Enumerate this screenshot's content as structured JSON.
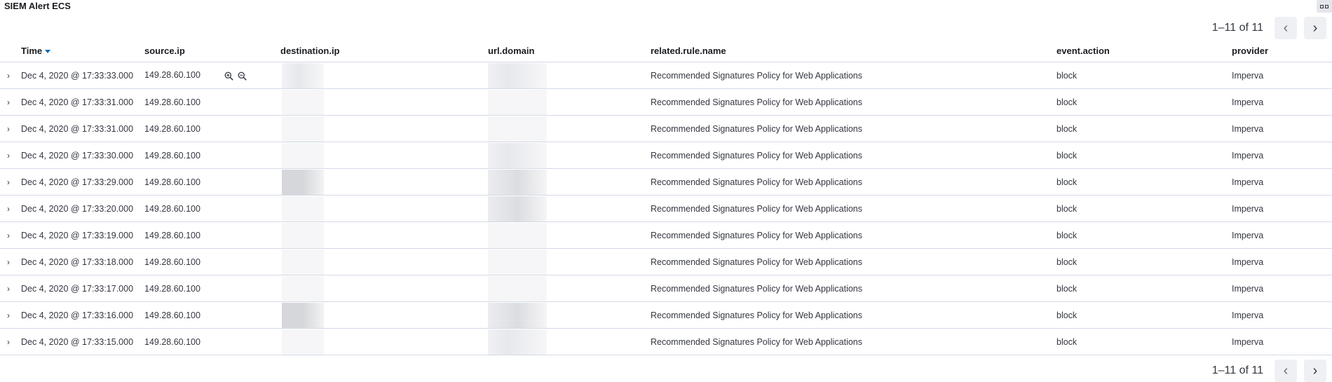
{
  "panel": {
    "title": "SIEM Alert ECS"
  },
  "pagination": {
    "range": "1–11 of 11"
  },
  "columns": {
    "time": "Time",
    "source_ip": "source.ip",
    "destination_ip": "destination.ip",
    "url_domain": "url.domain",
    "rule_name": "related.rule.name",
    "event_action": "event.action",
    "provider": "provider"
  },
  "rows": [
    {
      "time": "Dec 4, 2020 @ 17:33:33.000",
      "source_ip": "149.28.60.100",
      "destination_ip": "",
      "url_domain": "",
      "rule_name": "Recommended Signatures Policy for Web Applications",
      "event_action": "block",
      "provider": "Imperva"
    },
    {
      "time": "Dec 4, 2020 @ 17:33:31.000",
      "source_ip": "149.28.60.100",
      "destination_ip": "",
      "url_domain": "",
      "rule_name": "Recommended Signatures Policy for Web Applications",
      "event_action": "block",
      "provider": "Imperva"
    },
    {
      "time": "Dec 4, 2020 @ 17:33:31.000",
      "source_ip": "149.28.60.100",
      "destination_ip": "",
      "url_domain": "",
      "rule_name": "Recommended Signatures Policy for Web Applications",
      "event_action": "block",
      "provider": "Imperva"
    },
    {
      "time": "Dec 4, 2020 @ 17:33:30.000",
      "source_ip": "149.28.60.100",
      "destination_ip": "",
      "url_domain": "",
      "rule_name": "Recommended Signatures Policy for Web Applications",
      "event_action": "block",
      "provider": "Imperva"
    },
    {
      "time": "Dec 4, 2020 @ 17:33:29.000",
      "source_ip": "149.28.60.100",
      "destination_ip": "",
      "url_domain": "",
      "rule_name": "Recommended Signatures Policy for Web Applications",
      "event_action": "block",
      "provider": "Imperva"
    },
    {
      "time": "Dec 4, 2020 @ 17:33:20.000",
      "source_ip": "149.28.60.100",
      "destination_ip": "",
      "url_domain": "",
      "rule_name": "Recommended Signatures Policy for Web Applications",
      "event_action": "block",
      "provider": "Imperva"
    },
    {
      "time": "Dec 4, 2020 @ 17:33:19.000",
      "source_ip": "149.28.60.100",
      "destination_ip": "",
      "url_domain": "",
      "rule_name": "Recommended Signatures Policy for Web Applications",
      "event_action": "block",
      "provider": "Imperva"
    },
    {
      "time": "Dec 4, 2020 @ 17:33:18.000",
      "source_ip": "149.28.60.100",
      "destination_ip": "",
      "url_domain": "",
      "rule_name": "Recommended Signatures Policy for Web Applications",
      "event_action": "block",
      "provider": "Imperva"
    },
    {
      "time": "Dec 4, 2020 @ 17:33:17.000",
      "source_ip": "149.28.60.100",
      "destination_ip": "",
      "url_domain": "",
      "rule_name": "Recommended Signatures Policy for Web Applications",
      "event_action": "block",
      "provider": "Imperva"
    },
    {
      "time": "Dec 4, 2020 @ 17:33:16.000",
      "source_ip": "149.28.60.100",
      "destination_ip": "",
      "url_domain": "",
      "rule_name": "Recommended Signatures Policy for Web Applications",
      "event_action": "block",
      "provider": "Imperva"
    },
    {
      "time": "Dec 4, 2020 @ 17:33:15.000",
      "source_ip": "149.28.60.100",
      "destination_ip": "",
      "url_domain": "",
      "rule_name": "Recommended Signatures Policy for Web Applications",
      "event_action": "block",
      "provider": "Imperva"
    }
  ],
  "icons": {
    "expand": "chevron-right-icon",
    "zoom_in": "magnify-plus-icon",
    "zoom_out": "magnify-minus-icon",
    "prev": "chevron-left-icon",
    "next": "chevron-right-icon",
    "sort": "sort-descending-icon"
  },
  "colors": {
    "sort_accent": "#006bb8",
    "border": "#d3dae6"
  }
}
